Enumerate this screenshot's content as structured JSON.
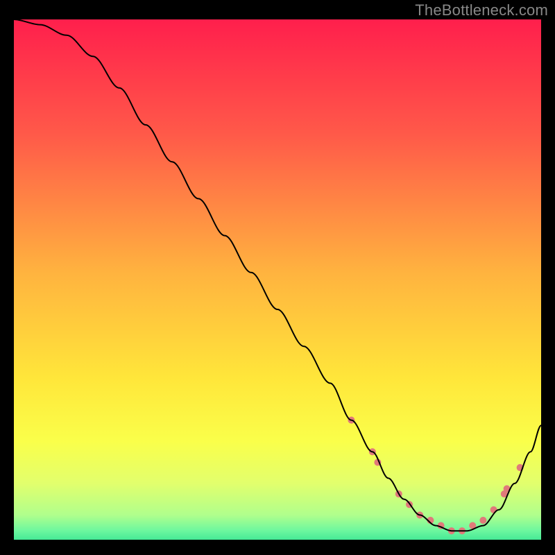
{
  "attribution": "TheBottleneck.com",
  "chart_data": {
    "type": "line",
    "title": "",
    "xlabel": "",
    "ylabel": "",
    "xlim": [
      0,
      100
    ],
    "ylim": [
      0,
      100
    ],
    "background_gradient_stops": [
      {
        "offset": 0,
        "color": "#ff1f4c"
      },
      {
        "offset": 22,
        "color": "#ff5a49"
      },
      {
        "offset": 48,
        "color": "#ffb33f"
      },
      {
        "offset": 68,
        "color": "#ffe63a"
      },
      {
        "offset": 80,
        "color": "#faff4a"
      },
      {
        "offset": 88,
        "color": "#e2ff6d"
      },
      {
        "offset": 94,
        "color": "#b0ff8c"
      },
      {
        "offset": 97,
        "color": "#6cf79f"
      },
      {
        "offset": 100,
        "color": "#27de8f"
      }
    ],
    "series": [
      {
        "name": "bottleneck-curve",
        "color": "#000000",
        "x": [
          0,
          5,
          10,
          15,
          20,
          25,
          30,
          35,
          40,
          45,
          50,
          55,
          60,
          64,
          68,
          71,
          74,
          77,
          80,
          83,
          86,
          89,
          92,
          95,
          98,
          100
        ],
        "y": [
          100,
          99,
          97,
          93,
          87,
          80,
          73,
          66,
          59,
          52,
          45,
          38,
          31,
          24,
          18,
          13,
          9,
          6,
          4,
          3,
          3,
          4,
          7,
          12,
          18,
          23
        ]
      }
    ],
    "markers": {
      "name": "highlight-points",
      "color": "#e07a7a",
      "radius": 5,
      "points": [
        {
          "x": 64,
          "y": 24
        },
        {
          "x": 68,
          "y": 18
        },
        {
          "x": 69,
          "y": 16
        },
        {
          "x": 73,
          "y": 10
        },
        {
          "x": 75,
          "y": 8
        },
        {
          "x": 77,
          "y": 6
        },
        {
          "x": 79,
          "y": 5
        },
        {
          "x": 81,
          "y": 4
        },
        {
          "x": 83,
          "y": 3
        },
        {
          "x": 85,
          "y": 3
        },
        {
          "x": 87,
          "y": 4
        },
        {
          "x": 89,
          "y": 5
        },
        {
          "x": 91,
          "y": 7
        },
        {
          "x": 93,
          "y": 10
        },
        {
          "x": 93.5,
          "y": 11
        },
        {
          "x": 96,
          "y": 15
        }
      ]
    }
  }
}
